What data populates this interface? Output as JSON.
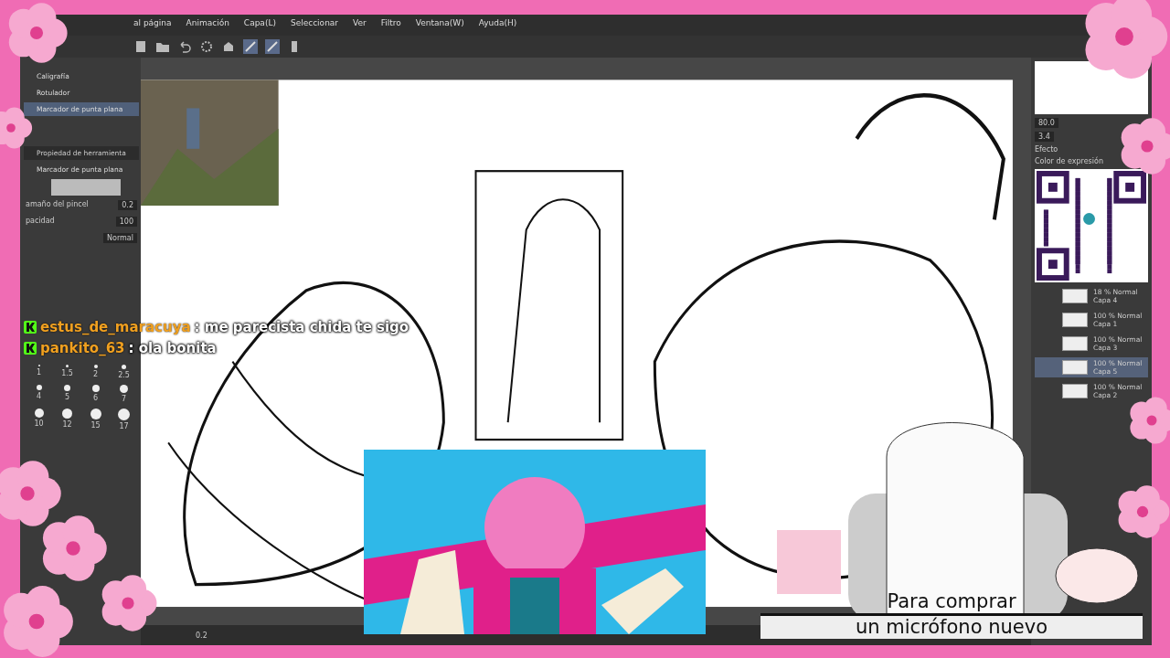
{
  "menu": [
    "al página",
    "Animación",
    "Capa(L)",
    "Seleccionar",
    "Ver",
    "Filtro",
    "Ventana(W)",
    "Ayuda(H)"
  ],
  "brushes": [
    {
      "label": "Caligrafía",
      "selected": false
    },
    {
      "label": "Rotulador",
      "selected": false
    },
    {
      "label": "Marcador de punta plana",
      "selected": true
    }
  ],
  "tool_property": {
    "title": "Propiedad de herramienta",
    "brush": "Marcador de punta plana",
    "fields": [
      {
        "label": "amaño del pincel",
        "value": "0.2"
      },
      {
        "label": "pacidad",
        "value": "100"
      }
    ],
    "blend": "Normal"
  },
  "brush_sizes": [
    "1",
    "1.5",
    "2",
    "2.5",
    "4",
    "5",
    "6",
    "7",
    "10",
    "12",
    "15",
    "17"
  ],
  "right_panel": {
    "nav_values": [
      "80.0",
      "3.4"
    ],
    "effect": "Efecto",
    "expression_color": "Color de expresión"
  },
  "layers": [
    {
      "mode": "18 % Normal",
      "name": "Capa 4",
      "selected": false
    },
    {
      "mode": "100 % Normal",
      "name": "Capa 1",
      "selected": false
    },
    {
      "mode": "100 % Normal",
      "name": "Capa 3",
      "selected": false
    },
    {
      "mode": "100 % Normal",
      "name": "Capa 5",
      "selected": true
    },
    {
      "mode": "100 % Normal",
      "name": "Capa 2",
      "selected": false
    }
  ],
  "chat": [
    {
      "user": "estus_de_maracuya",
      "message": ": me parecista chida te sigo"
    },
    {
      "user": "pankito_63",
      "message": ": ola bonita"
    }
  ],
  "zoom_value": "0.2",
  "goal": [
    "Para comprar",
    "un micrófono nuevo"
  ]
}
